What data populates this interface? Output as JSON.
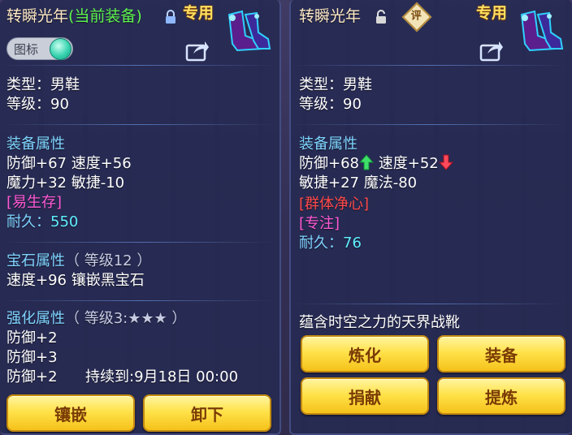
{
  "left": {
    "title_name": "转瞬光年",
    "title_tag": "(当前装备)",
    "exclusive": "专用",
    "toggle_label": "图标",
    "type_line": "类型：男鞋",
    "level_line": "等级：90",
    "equip_attr_header": "装备属性",
    "attr_line1": "防御+67 速度+56",
    "attr_line2": "魔力+32 敏捷-10",
    "special": "[易生存]",
    "durability_label": "耐久：",
    "durability_value": "550",
    "gem_header": "宝石属性",
    "gem_level": "（ 等级12 ）",
    "gem_line": "速度+96 镶嵌黑宝石",
    "enhance_header": "强化属性",
    "enhance_level": "（ 等级3:★★★ ）",
    "enhance_line1": "防御+2",
    "enhance_line2": "防御+3",
    "enhance_line3": "防御+2",
    "enhance_duration": "持续到:9月18日 00:00",
    "btn_inlay": "镶嵌",
    "btn_remove": "卸下"
  },
  "right": {
    "title_name": "转瞬光年",
    "exclusive": "专用",
    "eval_badge": "评",
    "type_line": "类型：男鞋",
    "level_line": "等级：90",
    "equip_attr_header": "装备属性",
    "defense": "防御+68",
    "speed": "速度+52",
    "attr_line2": "敏捷+27 魔法-80",
    "special1": "[群体净心]",
    "special2": "[专注]",
    "durability_label": "耐久：",
    "durability_value": "76",
    "description": "蕴含时空之力的天界战靴",
    "btn_refine": "炼化",
    "btn_equip": "装备",
    "btn_donate": "捐献",
    "btn_extract": "提炼"
  },
  "colors": {
    "accent_gold": "#ffe060",
    "section_blue": "#7fd4ff",
    "special_red": "#ff4a4a",
    "durability_cyan": "#5ff0ff",
    "title_green": "#5ff54f"
  },
  "icons": [
    "lock-closed-icon",
    "lock-open-icon",
    "share-icon",
    "boot-icon",
    "arrow-up-icon",
    "arrow-down-icon"
  ]
}
